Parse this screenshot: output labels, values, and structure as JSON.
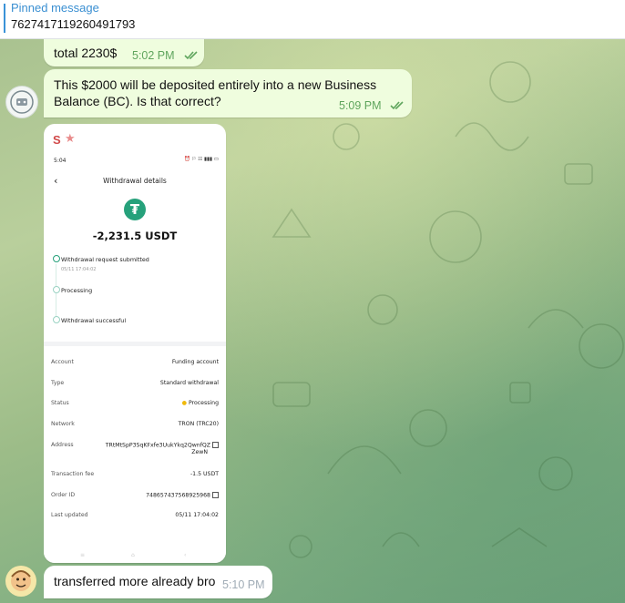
{
  "pinned": {
    "title": "Pinned message",
    "text": "7627417119260491793"
  },
  "messages": {
    "m1": {
      "text": "total 2230$",
      "time": "5:02 PM"
    },
    "m2": {
      "text": "This $2000 will be deposited entirely into a new Business Balance (BC). Is that correct?",
      "time": "5:09 PM"
    },
    "m3": {
      "sender": "S",
      "time": ""
    },
    "m4": {
      "text": "transferred more already bro",
      "time": "5:10 PM"
    }
  },
  "screenshot": {
    "status_time": "5:04",
    "title": "Withdrawal details",
    "amount": "-2,231.5 USDT",
    "steps": [
      {
        "label": "Withdrawal request submitted",
        "sub": "05/11 17:04:02"
      },
      {
        "label": "Processing"
      },
      {
        "label": "Withdrawal successful"
      }
    ],
    "rows": [
      {
        "label": "Account",
        "value": "Funding account"
      },
      {
        "label": "Type",
        "value": "Standard withdrawal"
      },
      {
        "label": "Status",
        "value": "Processing"
      },
      {
        "label": "Network",
        "value": "TRON (TRC20)"
      },
      {
        "label": "Address",
        "value": "TRtMtSpP3SqKFxfe3UukYkq2QwnfQZ",
        "value2": "ZewN"
      },
      {
        "label": "Transaction fee",
        "value": "-1.5 USDT"
      },
      {
        "label": "Order ID",
        "value": "748657437568925968"
      },
      {
        "label": "Last updated",
        "value": "05/11 17:04:02"
      }
    ]
  },
  "colors": {
    "bubble": "#effdde",
    "time": "#5fa55d",
    "accent": "#3a8fd2",
    "tether": "#26a17b",
    "status_dot": "#f0b90b"
  }
}
